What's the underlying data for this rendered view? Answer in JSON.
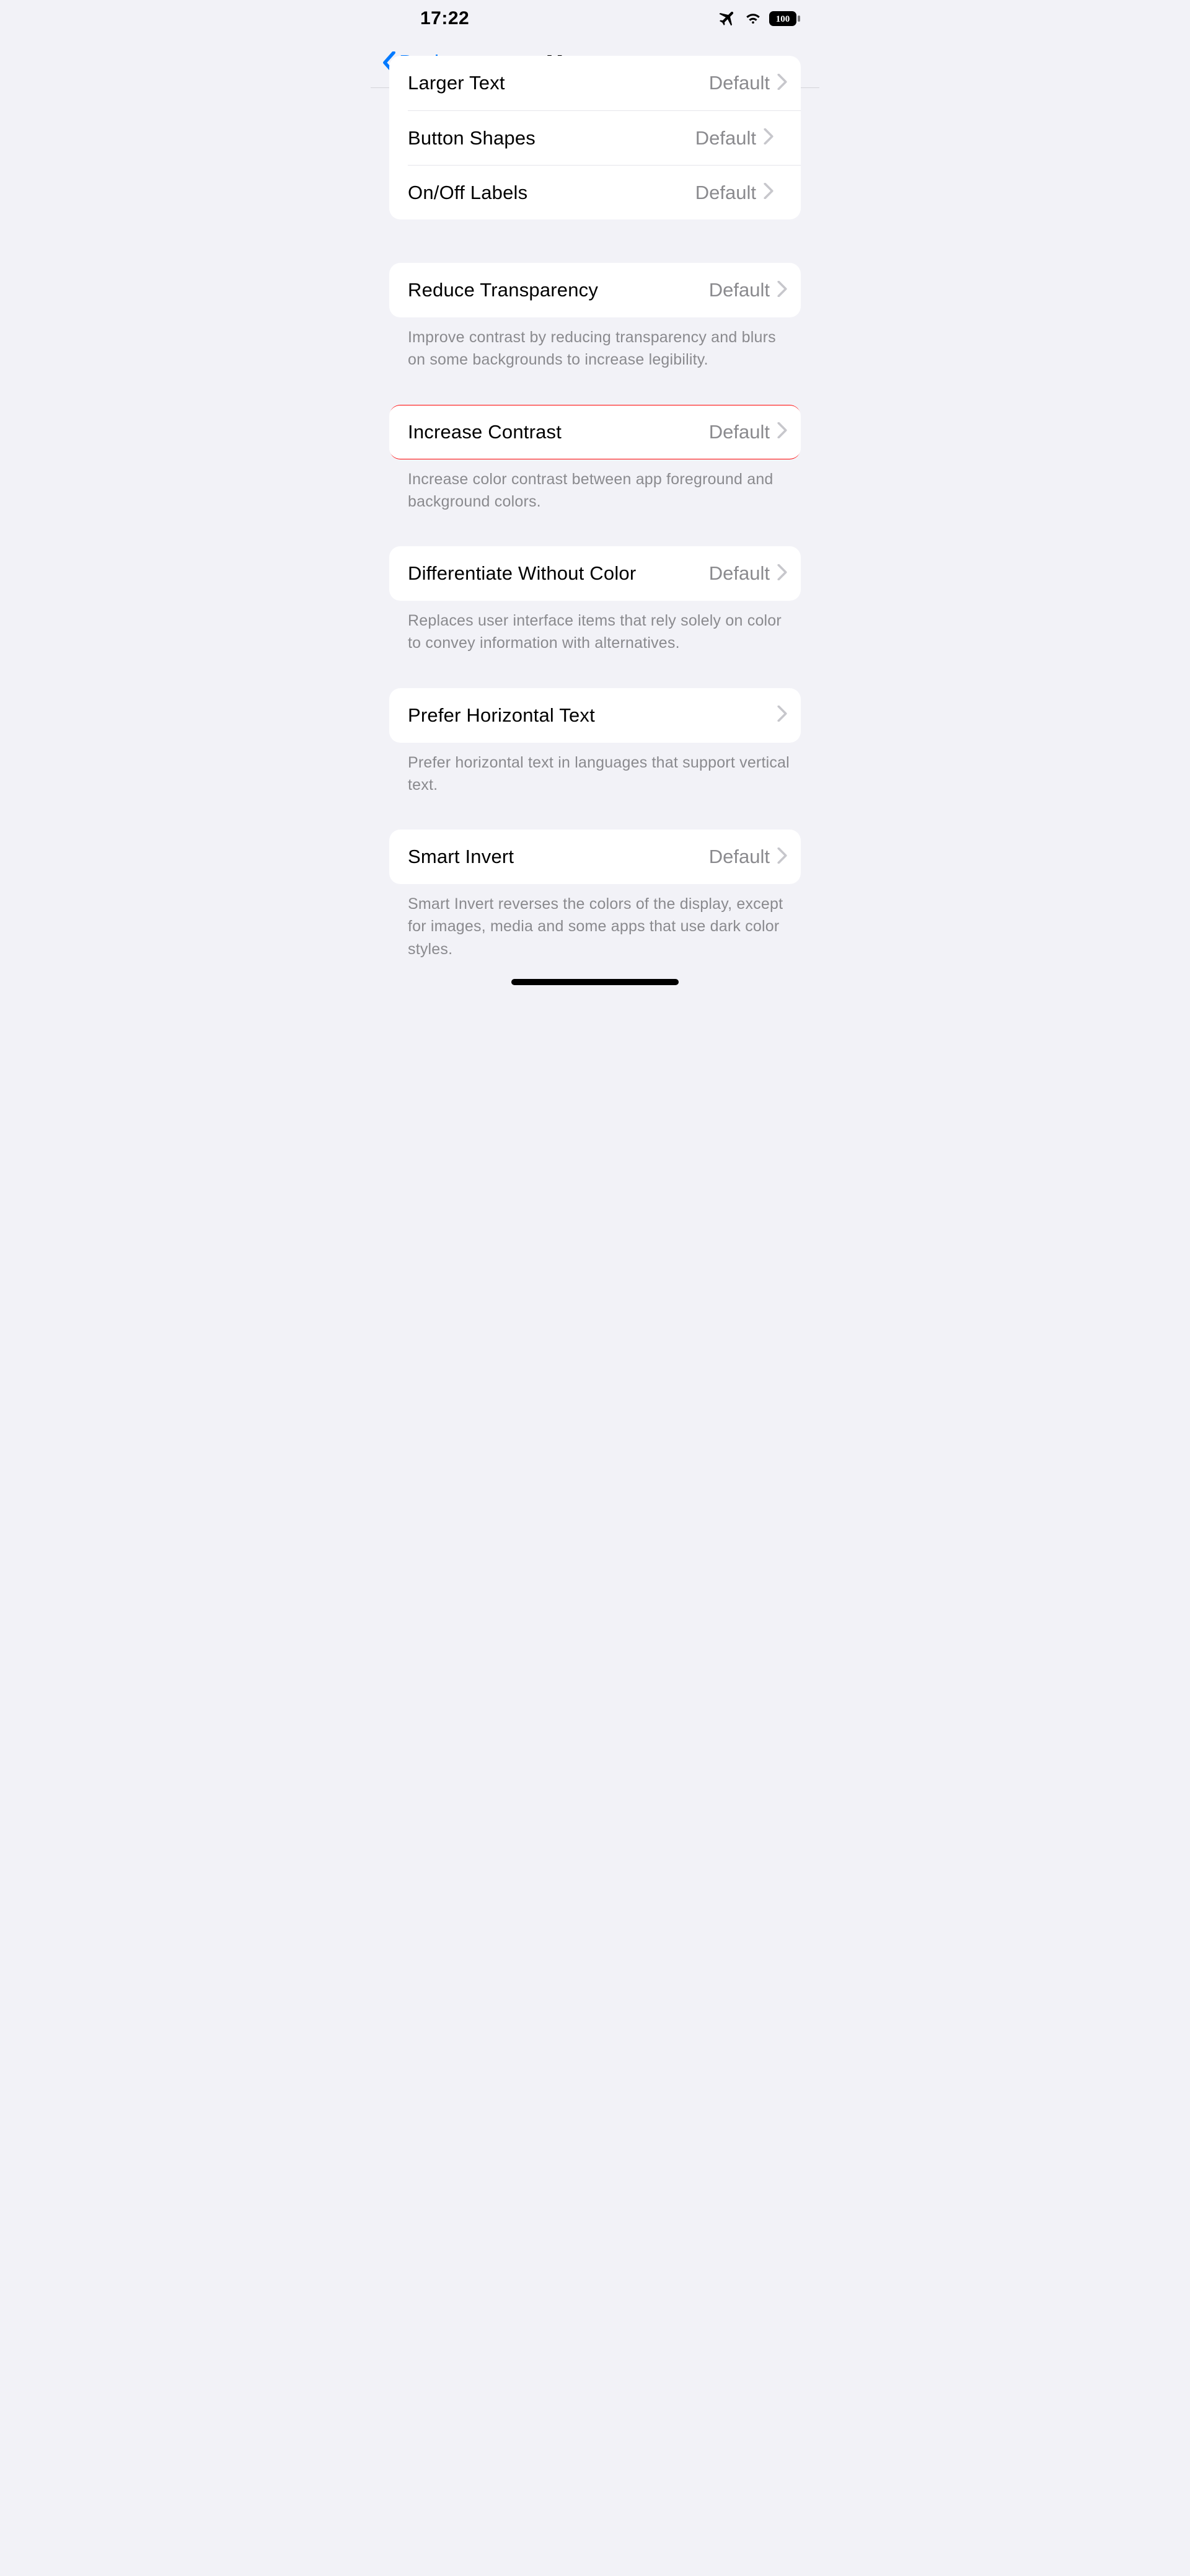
{
  "status": {
    "time": "17:22",
    "battery": "100"
  },
  "nav": {
    "back_label": "Back",
    "title": "Messages"
  },
  "rows": {
    "larger_text": {
      "label": "Larger Text",
      "value": "Default"
    },
    "button_shapes": {
      "label": "Button Shapes",
      "value": "Default"
    },
    "on_off_labels": {
      "label": "On/Off Labels",
      "value": "Default"
    },
    "reduce_transparency": {
      "label": "Reduce Transparency",
      "value": "Default"
    },
    "increase_contrast": {
      "label": "Increase Contrast",
      "value": "Default"
    },
    "differentiate_without_color": {
      "label": "Differentiate Without Color",
      "value": "Default"
    },
    "prefer_horizontal_text": {
      "label": "Prefer Horizontal Text"
    },
    "smart_invert": {
      "label": "Smart Invert",
      "value": "Default"
    }
  },
  "footers": {
    "reduce_transparency": "Improve contrast by reducing transparency and blurs on some backgrounds to increase legibility.",
    "increase_contrast": "Increase color contrast between app foreground and background colors.",
    "differentiate_without_color": "Replaces user interface items that rely solely on color to convey information with alternatives.",
    "prefer_horizontal_text": "Prefer horizontal text in languages that support vertical text.",
    "smart_invert": "Smart Invert reverses the colors of the display, except for images, media and some apps that use dark color styles."
  }
}
